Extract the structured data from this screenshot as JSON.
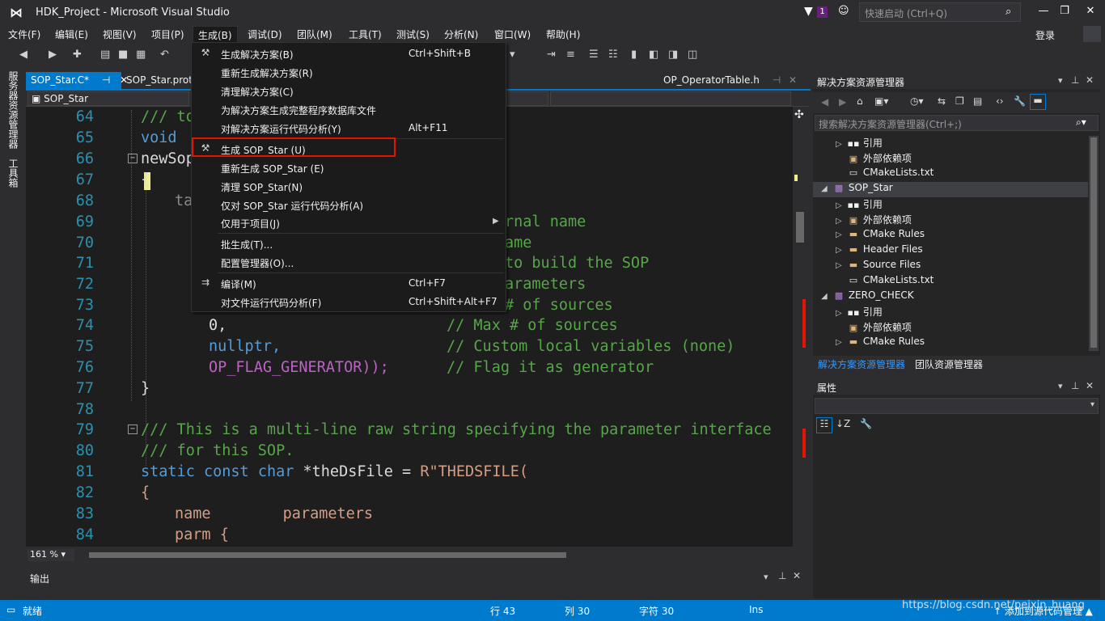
{
  "window": {
    "title": "HDK_Project - Microsoft Visual Studio",
    "notification_count": "1",
    "quick_launch_placeholder": "快速启动 (Ctrl+Q)",
    "sign_in": "登录"
  },
  "menu": [
    {
      "label": "文件(F)"
    },
    {
      "label": "编辑(E)"
    },
    {
      "label": "视图(V)"
    },
    {
      "label": "项目(P)"
    },
    {
      "label": "生成(B)",
      "active": true
    },
    {
      "label": "调试(D)"
    },
    {
      "label": "团队(M)"
    },
    {
      "label": "工具(T)"
    },
    {
      "label": "测试(S)"
    },
    {
      "label": "分析(N)"
    },
    {
      "label": "窗口(W)"
    },
    {
      "label": "帮助(H)"
    }
  ],
  "build_menu": [
    {
      "label": "生成解决方案(B)",
      "shortcut": "Ctrl+Shift+B",
      "icon": "build-icon"
    },
    {
      "label": "重新生成解决方案(R)",
      "shortcut": ""
    },
    {
      "label": "清理解决方案(C)",
      "shortcut": ""
    },
    {
      "label": "为解决方案生成完整程序数据库文件",
      "shortcut": ""
    },
    {
      "label": "对解决方案运行代码分析(Y)",
      "shortcut": "Alt+F11"
    },
    {
      "label": "生成 SOP_Star (U)",
      "shortcut": "",
      "icon": "build-icon",
      "highlighted": true
    },
    {
      "label": "重新生成 SOP_Star (E)",
      "shortcut": ""
    },
    {
      "label": "清理 SOP_Star(N)",
      "shortcut": ""
    },
    {
      "label": "仅对 SOP_Star 运行代码分析(A)",
      "shortcut": ""
    },
    {
      "label": "仅用于项目(J)",
      "shortcut": "",
      "submenu": true
    },
    {
      "label": "批生成(T)...",
      "shortcut": ""
    },
    {
      "label": "配置管理器(O)...",
      "shortcut": ""
    },
    {
      "label": "编译(M)",
      "shortcut": "Ctrl+F7",
      "icon": "compile-icon"
    },
    {
      "label": "对文件运行代码分析(F)",
      "shortcut": "Ctrl+Shift+Alt+F7"
    }
  ],
  "left_strip": {
    "server_explorer": "服务器资源管理器",
    "toolbox": "工具箱"
  },
  "doc_tabs": {
    "active": "SOP_Star.C*",
    "second": "SOP_Star.prot",
    "right": "OP_OperatorTable.h"
  },
  "nav": {
    "scope": "SOP_Star"
  },
  "code_lines": [
    {
      "n": "64",
      "text": "/// to"
    },
    {
      "n": "65",
      "text": "void"
    },
    {
      "n": "66",
      "text": "newSop"
    },
    {
      "n": "67",
      "text": "{"
    },
    {
      "n": "68",
      "text": "ta"
    },
    {
      "n": "69",
      "text": "rnal name"
    },
    {
      "n": "70",
      "text": "ame"
    },
    {
      "n": "71",
      "text": "to build the SOP"
    },
    {
      "n": "72",
      "text": "arameters"
    },
    {
      "n": "73",
      "text": "# of sources"
    },
    {
      "n": "74",
      "text": "0,",
      "comment": "// Max # of sources"
    },
    {
      "n": "75",
      "text": "nullptr,",
      "comment": "// Custom local variables (none)"
    },
    {
      "n": "76",
      "text": "OP_FLAG_GENERATOR));",
      "comment": "// Flag it as generator"
    },
    {
      "n": "77",
      "text": "}"
    },
    {
      "n": "78",
      "text": ""
    },
    {
      "n": "79",
      "text": "/// This is a multi-line raw string specifying the parameter interface"
    },
    {
      "n": "80",
      "text": "/// for this SOP."
    },
    {
      "n": "81",
      "text": "static const char *theDsFile = R\"THEDSFILE("
    },
    {
      "n": "82",
      "text": "{"
    },
    {
      "n": "83",
      "text": "name        parameters"
    },
    {
      "n": "84",
      "text": "parm {"
    }
  ],
  "code_kw": {
    "static": "static",
    "const": "const",
    "char": "char",
    "rest": " *theDsFile = ",
    "raw": "R\"THEDSFILE("
  },
  "editor": {
    "zoom": "161 %"
  },
  "output": {
    "title": "输出"
  },
  "solution_explorer": {
    "title": "解决方案资源管理器",
    "search_placeholder": "搜索解决方案资源管理器(Ctrl+;)",
    "items": [
      {
        "label": "引用",
        "icon": "references-icon",
        "indent": 1,
        "expand": true
      },
      {
        "label": "外部依赖项",
        "icon": "external-deps-icon",
        "indent": 1,
        "expand": false
      },
      {
        "label": "CMakeLists.txt",
        "icon": "file-icon",
        "indent": 1,
        "expand": false
      },
      {
        "label": "SOP_Star",
        "icon": "project-icon",
        "indent": 0,
        "expand": "open",
        "selected": true
      },
      {
        "label": "引用",
        "icon": "references-icon",
        "indent": 1,
        "expand": true
      },
      {
        "label": "外部依赖项",
        "icon": "external-deps-icon",
        "indent": 1,
        "expand": true
      },
      {
        "label": "CMake Rules",
        "icon": "folder-icon",
        "indent": 1,
        "expand": true
      },
      {
        "label": "Header Files",
        "icon": "folder-icon",
        "indent": 1,
        "expand": true
      },
      {
        "label": "Source Files",
        "icon": "folder-icon",
        "indent": 1,
        "expand": true
      },
      {
        "label": "CMakeLists.txt",
        "icon": "file-icon",
        "indent": 1,
        "expand": false
      },
      {
        "label": "ZERO_CHECK",
        "icon": "project-icon",
        "indent": 0,
        "expand": "open"
      },
      {
        "label": "引用",
        "icon": "references-icon",
        "indent": 1,
        "expand": true
      },
      {
        "label": "外部依赖项",
        "icon": "external-deps-icon",
        "indent": 1,
        "expand": false
      },
      {
        "label": "CMake Rules",
        "icon": "folder-icon",
        "indent": 1,
        "expand": true
      }
    ],
    "tab_solution": "解决方案资源管理器",
    "tab_team": "团队资源管理器"
  },
  "properties": {
    "title": "属性"
  },
  "status": {
    "ready": "就绪",
    "row": "行 43",
    "col": "列 30",
    "char": "字符 30",
    "ins": "Ins",
    "add_source": "↑ 添加到源代码管理 ▲"
  },
  "watermark": "https://blog.csdn.net/peixin_huang",
  "colors": {
    "accent": "#007acc",
    "highlight_border": "#e51400",
    "comment": "#57a64a",
    "keyword": "#569cd6",
    "macro": "#bd63c5"
  }
}
